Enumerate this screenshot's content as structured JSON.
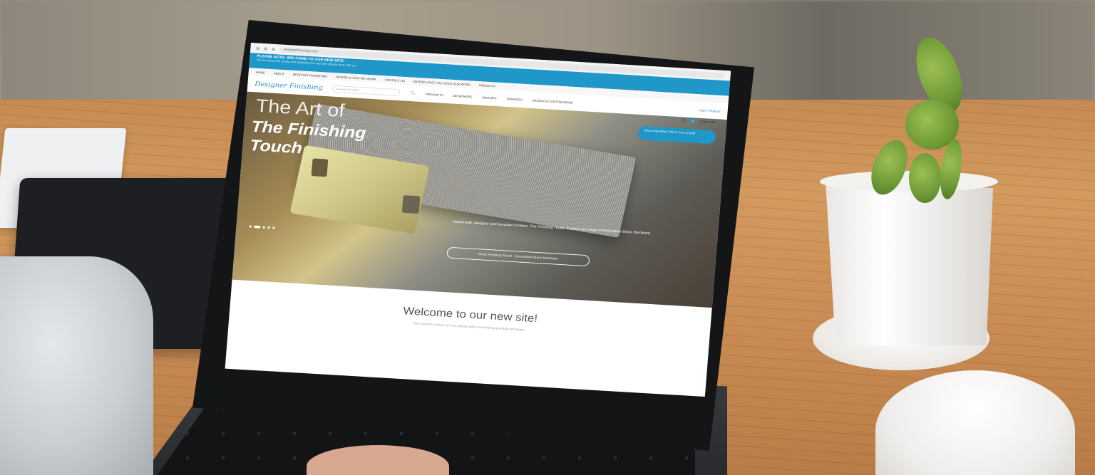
{
  "browser": {
    "url": "designerfinishing.com"
  },
  "notice": {
    "title": "PLEASE NOTE: WELCOME TO OUR NEW SITE!",
    "subtitle": "We are busy fine tuning and updating our new site please bear with us"
  },
  "top_nav": [
    "Home",
    "About",
    "Bespoke Furniture",
    "Where & How We Work",
    "Contact Us",
    "Where Have You Seen Our Work",
    "Press Kit"
  ],
  "brand": {
    "logo": "Designer Finishing",
    "search_placeholder": "Search the store",
    "account": "Login / Register"
  },
  "main_nav": [
    "Products",
    "Designers",
    "Visitors",
    "Services",
    "Design & Custom Work"
  ],
  "cart": {
    "count": "0",
    "label": "£0.00 GBP"
  },
  "chat_widget": {
    "text": "Have a question? We're here to help"
  },
  "hero": {
    "title_line1": "The Art of",
    "title_line2": "The Finishing Touch",
    "body": "Handmade, designer and bespoke furniture. The Finishing Touch. Explore our range of Decorative Brass Hardware.",
    "button": "Shop Finishing Touch - Decorative Brass Hardware"
  },
  "welcome": {
    "heading": "Welcome to our new site!",
    "text": "We're proud to deliver our new website with more finishing products and design."
  },
  "colors": {
    "accent": "#1f97c9"
  }
}
